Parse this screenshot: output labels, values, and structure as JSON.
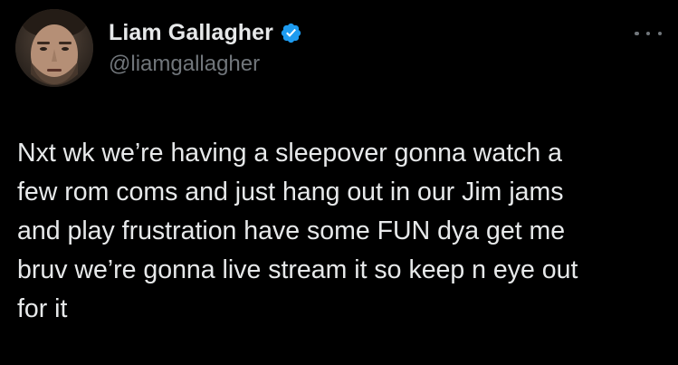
{
  "author": {
    "display_name": "Liam Gallagher",
    "handle": "@liamgallagher",
    "verified": true,
    "verified_color": "#1d9bf0"
  },
  "tweet": {
    "lines": [
      "Nxt wk we’re having a sleepover gonna watch a",
      "few rom coms and just hang out in our Jim jams",
      "and play frustration have some FUN dya get me",
      "bruv we’re gonna live stream it so keep n eye out",
      "for it"
    ]
  },
  "icons": {
    "verified": "verified-badge-icon",
    "more": "more-options-icon"
  },
  "theme": {
    "background": "#000000",
    "text": "#e7e9ea",
    "secondary_text": "#71767b"
  }
}
